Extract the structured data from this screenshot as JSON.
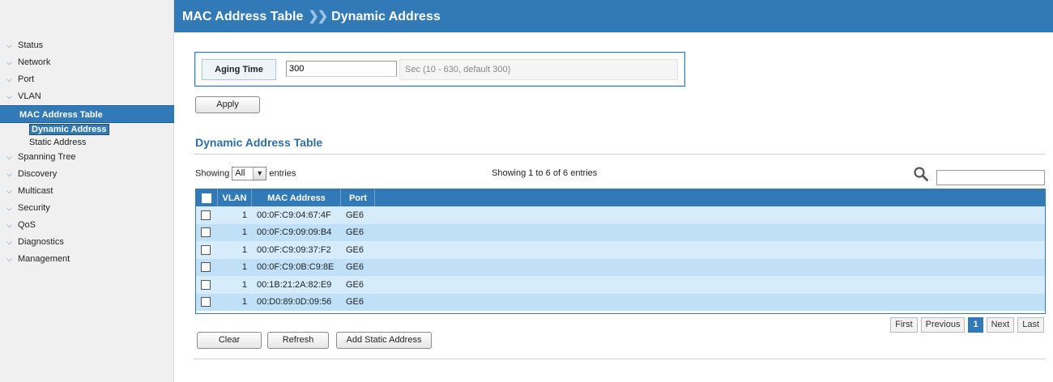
{
  "header": {
    "section": "MAC Address Table",
    "separator": "❯❯",
    "page": "Dynamic Address"
  },
  "sidebar": {
    "items_before": [
      {
        "label": "Status"
      },
      {
        "label": "Network"
      },
      {
        "label": "Port"
      },
      {
        "label": "VLAN"
      }
    ],
    "active": "MAC Address Table",
    "subitems": [
      {
        "label": "Dynamic Address",
        "selected": true
      },
      {
        "label": "Static Address",
        "selected": false
      }
    ],
    "items_after": [
      {
        "label": "Spanning Tree"
      },
      {
        "label": "Discovery"
      },
      {
        "label": "Multicast"
      },
      {
        "label": "Security"
      },
      {
        "label": "QoS"
      },
      {
        "label": "Diagnostics"
      },
      {
        "label": "Management"
      }
    ]
  },
  "aging": {
    "label": "Aging Time",
    "value": "300",
    "hint": "Sec (10 - 630, default 300)"
  },
  "apply_label": "Apply",
  "table_section": {
    "title": "Dynamic Address Table",
    "showing_prefix": "Showing",
    "showing_select": "All",
    "showing_suffix": "entries",
    "showing_info": "Showing 1 to 6 of 6 entries",
    "search_value": ""
  },
  "table": {
    "columns": [
      "VLAN",
      "MAC Address",
      "Port"
    ],
    "rows": [
      {
        "vlan": "1",
        "mac": "00:0F:C9:04:67:4F",
        "port": "GE6"
      },
      {
        "vlan": "1",
        "mac": "00:0F:C9:09:09:B4",
        "port": "GE6"
      },
      {
        "vlan": "1",
        "mac": "00:0F:C9:09:37:F2",
        "port": "GE6"
      },
      {
        "vlan": "1",
        "mac": "00:0F:C9:0B:C9:8E",
        "port": "GE6"
      },
      {
        "vlan": "1",
        "mac": "00:1B:21:2A:82:E9",
        "port": "GE6"
      },
      {
        "vlan": "1",
        "mac": "00:D0:89:0D:09:56",
        "port": "GE6"
      }
    ]
  },
  "pagination": {
    "first": "First",
    "previous": "Previous",
    "current": "1",
    "next": "Next",
    "last": "Last"
  },
  "actions": {
    "clear": "Clear",
    "refresh": "Refresh",
    "add_static": "Add Static Address"
  },
  "icons": {
    "nav_chevron": "chevron-down-icon",
    "search": "search-icon",
    "select_arrow": "chevron-down-icon"
  },
  "colors": {
    "brand": "#3279b7",
    "row_light": "#d6ecfb",
    "row_dark": "#bfe0f7"
  }
}
